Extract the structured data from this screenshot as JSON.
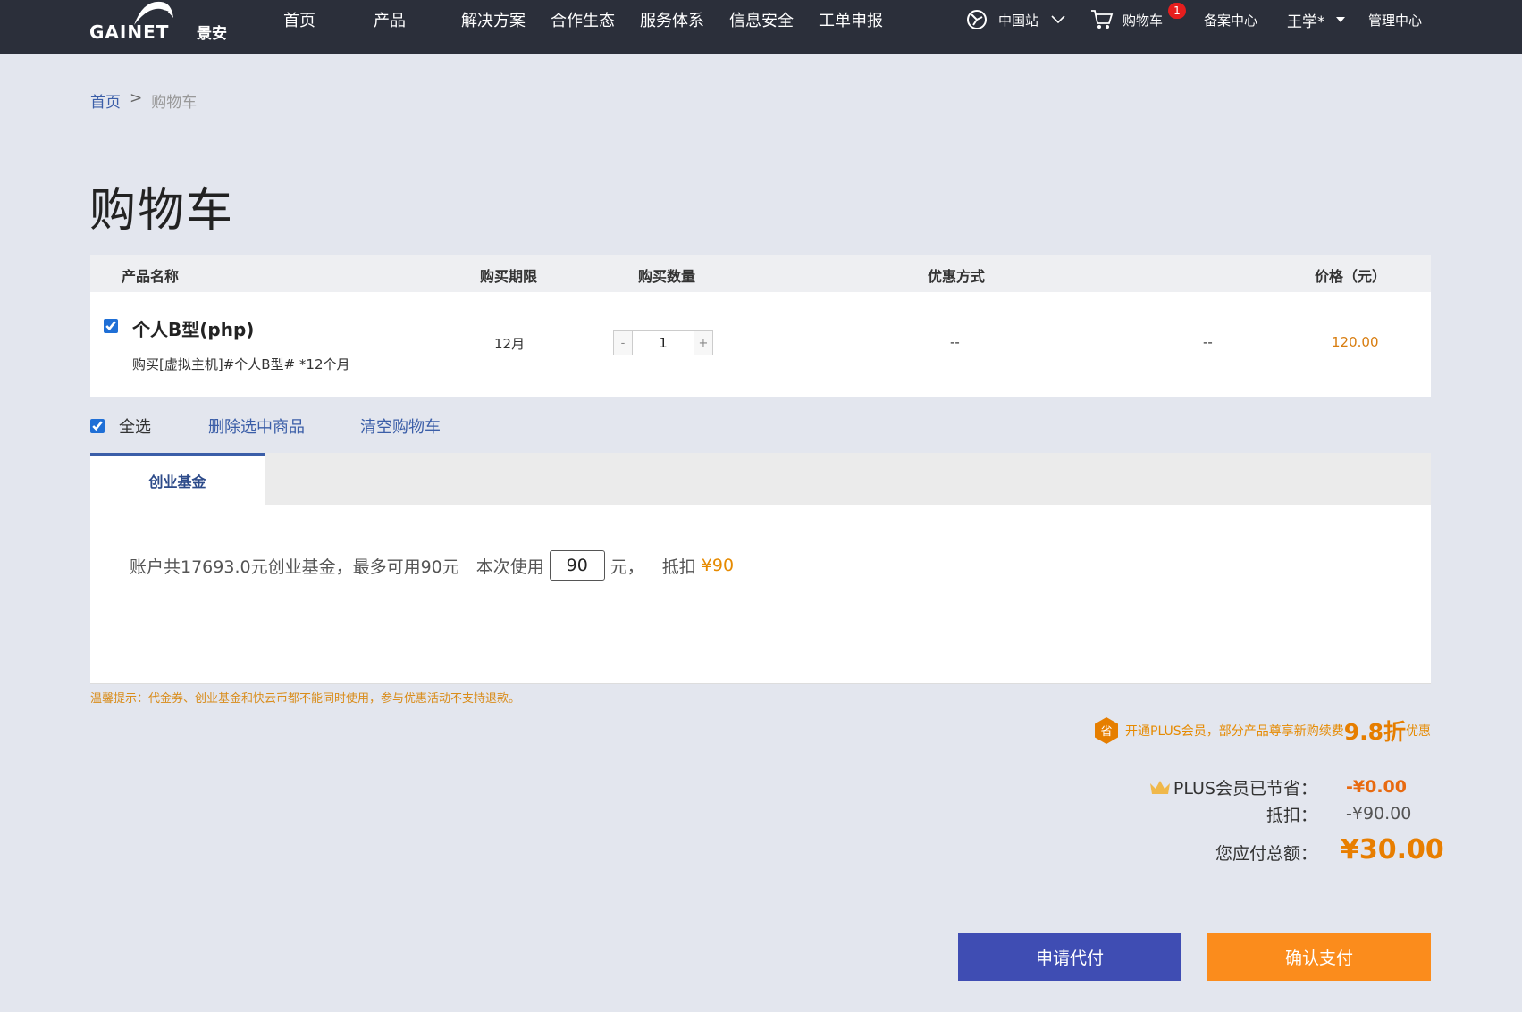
{
  "header": {
    "logo_text": "GAINET景安",
    "nav": [
      "首页",
      "产品",
      "解决方案",
      "合作生态",
      "服务体系",
      "信息安全",
      "工单申报"
    ],
    "site": "中国站",
    "cart": "购物车",
    "cart_count": "1",
    "beian": "备案中心",
    "user": "王学*",
    "admin": "管理中心"
  },
  "breadcrumb": {
    "home": "首页",
    "separator": ">",
    "current": "购物车"
  },
  "page_title": "购物车",
  "table": {
    "headers": {
      "name": "产品名称",
      "period": "购买期限",
      "quantity": "购买数量",
      "discount": "优惠方式",
      "price": "价格（元）"
    },
    "rows": [
      {
        "name": "个人B型(php)",
        "desc": "购买[虚拟主机]#个人B型# *12个月",
        "period": "12月",
        "quantity": "1",
        "discount": "--",
        "extra": "--",
        "price": "120.00",
        "checked": true
      }
    ],
    "stepper_minus": "-",
    "stepper_plus": "+"
  },
  "actions": {
    "select_all": "全选",
    "delete_selected": "删除选中商品",
    "clear_cart": "清空购物车"
  },
  "fund": {
    "tab": "创业基金",
    "text_before": "账户共17693.0元创业基金，最多可用90元　本次使用",
    "amount": "90",
    "unit": "元，",
    "deduct_label": "抵扣",
    "deduct_value": "¥90"
  },
  "tip": "温馨提示：代金券、创业基金和快云币都不能同时使用，参与优惠活动不支持退款。",
  "plus": {
    "badge": "省",
    "text": "开通PLUS会员，部分产品尊享新购续费",
    "discount": "9.8折",
    "suffix": "优惠"
  },
  "summary": {
    "plus_saved_label": "PLUS会员已节省：",
    "plus_saved_value": "-¥0.00",
    "deduct_label": "抵扣：",
    "deduct_value": "-¥90.00",
    "total_label": "您应付总额：",
    "total_value": "¥30.00"
  },
  "buttons": {
    "agent_pay": "申请代付",
    "confirm_pay": "确认支付"
  },
  "colors": {
    "nav_bg": "#2b2f3a",
    "primary_blue": "#3f4db3",
    "accent_orange": "#fb8c1c",
    "price_orange": "#d87d10"
  }
}
